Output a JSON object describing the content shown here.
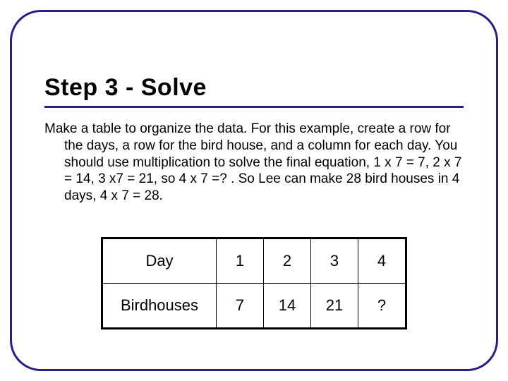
{
  "title": "Step 3 - Solve",
  "body": "Make a table to organize the data. For this example, create a row for the days, a row for the bird house, and a column for each day.  You should use multiplication to solve the final equation, 1 x 7 = 7, 2 x 7 = 14, 3 x7 = 21, so 4 x 7 =? .  So Lee can make 28 bird houses in 4 days, 4 x 7 = 28.",
  "table": {
    "rows": [
      {
        "label": "Day",
        "cells": [
          "1",
          "2",
          "3",
          "4"
        ]
      },
      {
        "label": "Birdhouses",
        "cells": [
          "7",
          "14",
          "21",
          "?"
        ]
      }
    ]
  }
}
